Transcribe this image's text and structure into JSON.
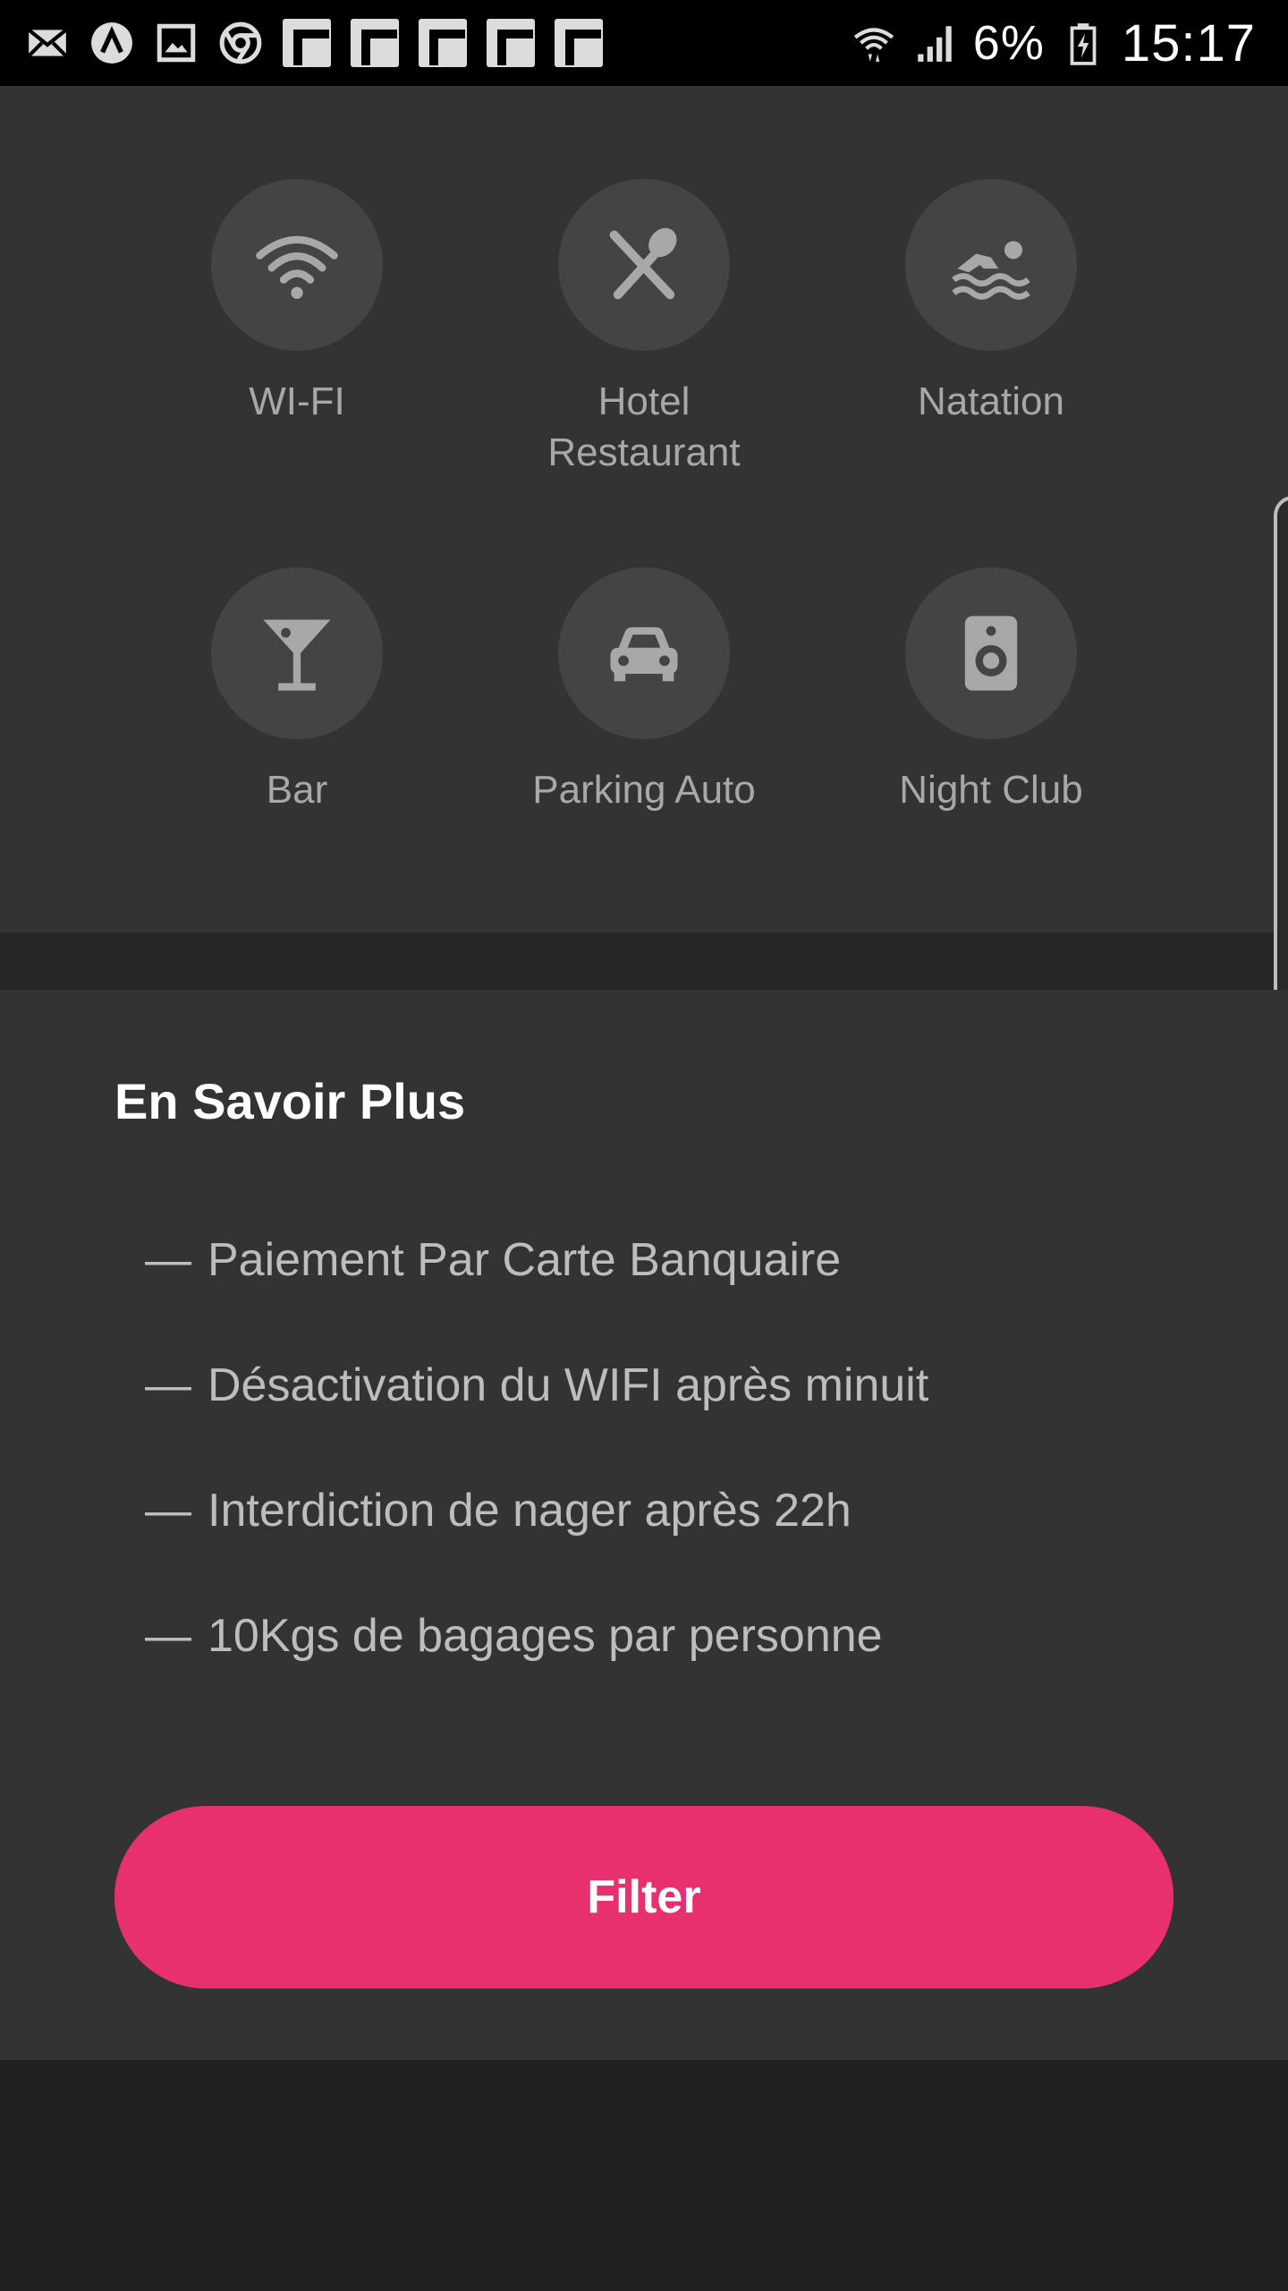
{
  "status_bar": {
    "battery_percent": "6%",
    "time": "15:17",
    "notification_icons": [
      "mail-icon",
      "app-icon",
      "image-icon",
      "chrome-icon",
      "flipboard-icon",
      "flipboard-icon",
      "flipboard-icon",
      "flipboard-icon",
      "flipboard-icon"
    ],
    "system_icons": [
      "wifi-icon",
      "signal-icon",
      "battery-charging-icon"
    ]
  },
  "amenities": [
    {
      "label": "WI-FI",
      "icon": "wifi-icon"
    },
    {
      "label": "Hotel\nRestaurant",
      "icon": "restaurant-icon"
    },
    {
      "label": "Natation",
      "icon": "swimming-icon"
    },
    {
      "label": "Bar",
      "icon": "cocktail-icon"
    },
    {
      "label": "Parking Auto",
      "icon": "car-icon"
    },
    {
      "label": "Night Club",
      "icon": "speaker-icon"
    }
  ],
  "info": {
    "title": "En Savoir Plus",
    "dash": "—",
    "items": [
      "Paiement Par Carte Banquaire",
      "Désactivation du WIFI après minuit",
      "Interdiction de nager après 22h",
      "10Kgs de bagages par personne"
    ]
  },
  "filter_button": {
    "label": "Filter"
  },
  "colors": {
    "accent": "#e8306e",
    "panel": "#333333",
    "background": "#212121",
    "icon_circle": "#444444",
    "icon_fill": "#a8a8a8"
  }
}
